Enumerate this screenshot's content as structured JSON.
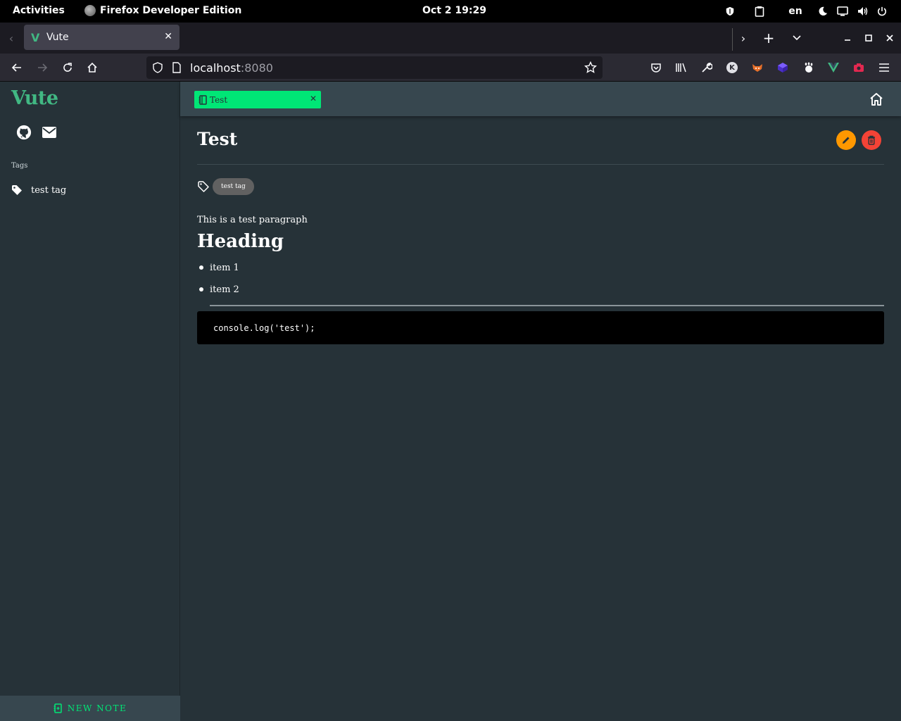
{
  "system_bar": {
    "activities": "Activities",
    "app_name": "Firefox Developer Edition",
    "clock": "Oct 2  19:29",
    "language": "en"
  },
  "browser": {
    "tab_title": "Vute",
    "url_host": "localhost",
    "url_port": ":8080"
  },
  "sidebar": {
    "brand": "Vute",
    "tags_heading": "Tags",
    "tags": [
      "test tag"
    ],
    "new_note_label": "NEW NOTE"
  },
  "note_tab": {
    "label": "Test"
  },
  "note": {
    "title": "Test",
    "tags": [
      "test tag"
    ],
    "paragraph": "This is a test paragraph",
    "heading": "Heading",
    "list_items": [
      "item 1",
      "item 2"
    ],
    "code": "console.log('test');"
  },
  "colors": {
    "accent_green": "#00e676",
    "brand_green": "#41b883",
    "edit_orange": "#ff9800",
    "delete_red": "#f44336",
    "background": "#263238"
  }
}
